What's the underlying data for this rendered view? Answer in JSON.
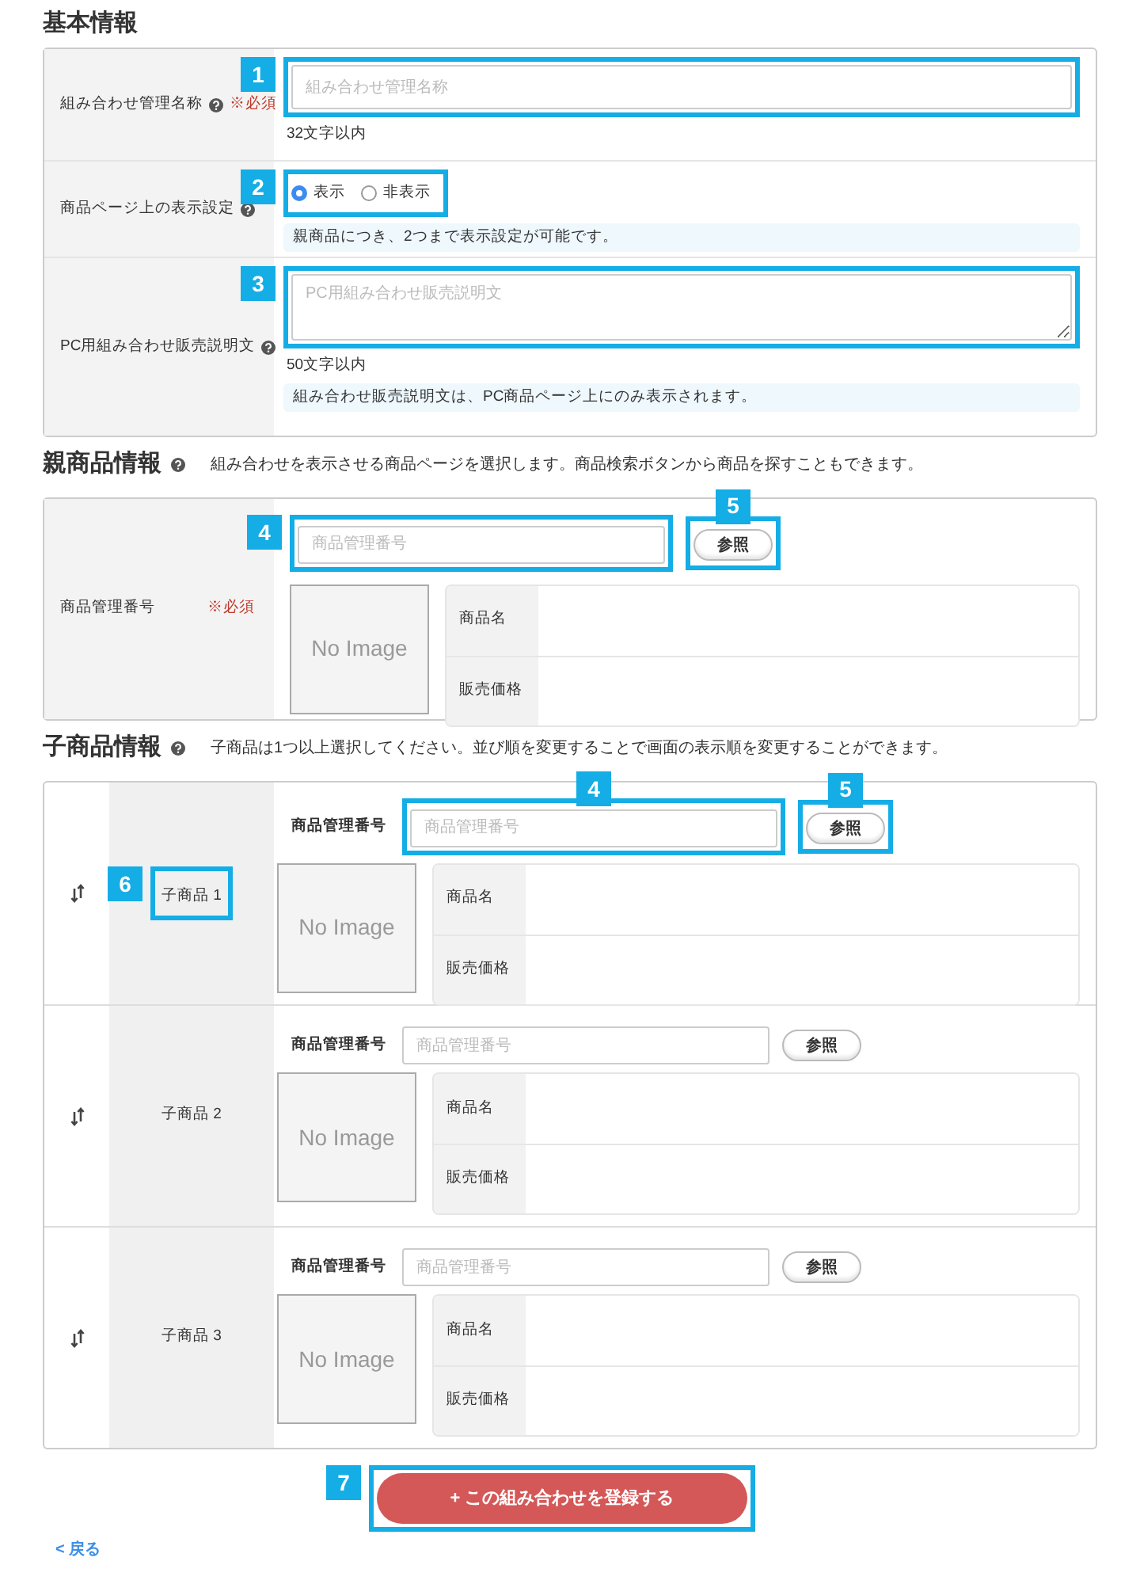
{
  "basic": {
    "title": "基本情報",
    "rows": [
      {
        "kind": "text",
        "label": "組み合わせ管理名称",
        "help": true,
        "required": "※必須",
        "placeholder": "組み合わせ管理名称",
        "callout": "1",
        "note": "32文字以内"
      },
      {
        "kind": "radio",
        "label": "商品ページ上の表示設定",
        "help": true,
        "options": [
          {
            "label": "表示",
            "selected": true
          },
          {
            "label": "非表示",
            "selected": false
          }
        ],
        "callout": "2",
        "info": "親商品につき、2つまで表示設定が可能です。"
      },
      {
        "kind": "textarea",
        "label": "PC用組み合わせ販売説明文",
        "help": true,
        "placeholder": "PC用組み合わせ販売説明文",
        "callout": "3",
        "note": "50文字以内",
        "info": "組み合わせ販売説明文は、PC商品ページ上にのみ表示されます。"
      }
    ]
  },
  "parent": {
    "title": "親商品情報",
    "help": true,
    "description": "組み合わせを表示させる商品ページを選択します。商品検索ボタンから商品を探すこともできます。",
    "label": "商品管理番号",
    "required": "※必須",
    "placeholder": "商品管理番号",
    "input_callout": "4",
    "button": "参照",
    "button_callout": "5",
    "image": "No Image",
    "fields": [
      "商品名",
      "販売価格"
    ]
  },
  "children": {
    "title": "子商品情報",
    "help": true,
    "description": "子商品は1つ以上選択してください。並び順を変更することで画面の表示順を変更することができます。",
    "items": [
      {
        "label": "子商品 1",
        "label_callout": "6",
        "field_label": "商品管理番号",
        "placeholder": "商品管理番号",
        "input_callout": "4",
        "button": "参照",
        "button_callout": "5",
        "image": "No Image",
        "fields": [
          "商品名",
          "販売価格"
        ]
      },
      {
        "label": "子商品 2",
        "field_label": "商品管理番号",
        "placeholder": "商品管理番号",
        "button": "参照",
        "image": "No Image",
        "fields": [
          "商品名",
          "販売価格"
        ]
      },
      {
        "label": "子商品 3",
        "field_label": "商品管理番号",
        "placeholder": "商品管理番号",
        "button": "参照",
        "image": "No Image",
        "fields": [
          "商品名",
          "販売価格"
        ]
      }
    ]
  },
  "submit": {
    "label": "+ この組み合わせを登録する",
    "callout": "7"
  },
  "back_link": "< 戻る"
}
